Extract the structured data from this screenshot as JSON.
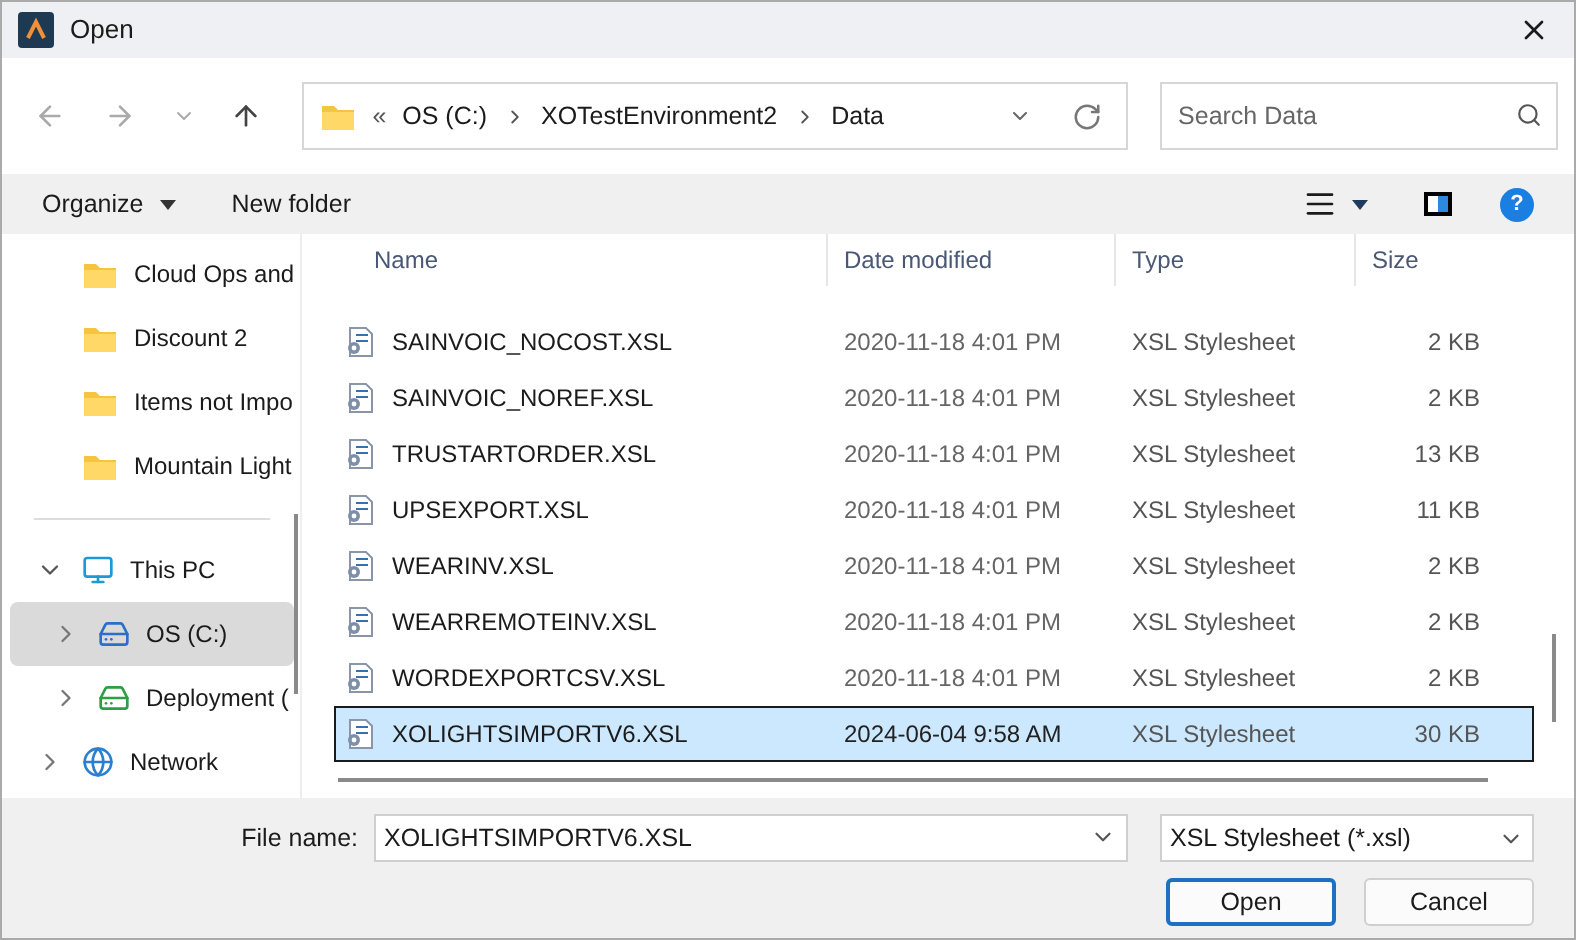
{
  "window": {
    "title": "Open"
  },
  "address_bar": {
    "overflow": "«",
    "path": [
      "OS (C:)",
      "XOTestEnvironment2",
      "Data"
    ]
  },
  "search": {
    "placeholder": "Search Data"
  },
  "toolbar": {
    "organize": "Organize",
    "new_folder": "New folder",
    "help": "?"
  },
  "sidebar": {
    "items": [
      {
        "label": "Cloud Ops and",
        "kind": "folder",
        "selected": false
      },
      {
        "label": "Discount 2",
        "kind": "folder",
        "selected": false
      },
      {
        "label": "Items not Impo",
        "kind": "folder",
        "selected": false
      },
      {
        "label": "Mountain Light",
        "kind": "folder",
        "selected": false
      },
      {
        "label": "This PC",
        "kind": "pc",
        "selected": false,
        "expanded": true,
        "children": [
          {
            "label": "OS (C:)",
            "kind": "os-drive",
            "selected": true,
            "expanded": false
          },
          {
            "label": "Deployment (",
            "kind": "drive",
            "selected": false,
            "expanded": false
          }
        ]
      },
      {
        "label": "Network",
        "kind": "network",
        "selected": false,
        "expanded": false
      }
    ]
  },
  "table": {
    "columns": [
      "Name",
      "Date modified",
      "Type",
      "Size"
    ],
    "rows": [
      {
        "name": "SAINVOIC_NOCOST.XSL",
        "date": "2020-11-18 4:01 PM",
        "type": "XSL Stylesheet",
        "size": "2 KB",
        "selected": false
      },
      {
        "name": "SAINVOIC_NOREF.XSL",
        "date": "2020-11-18 4:01 PM",
        "type": "XSL Stylesheet",
        "size": "2 KB",
        "selected": false
      },
      {
        "name": "TRUSTARTORDER.XSL",
        "date": "2020-11-18 4:01 PM",
        "type": "XSL Stylesheet",
        "size": "13 KB",
        "selected": false
      },
      {
        "name": "UPSEXPORT.XSL",
        "date": "2020-11-18 4:01 PM",
        "type": "XSL Stylesheet",
        "size": "11 KB",
        "selected": false
      },
      {
        "name": "WEARINV.XSL",
        "date": "2020-11-18 4:01 PM",
        "type": "XSL Stylesheet",
        "size": "2 KB",
        "selected": false
      },
      {
        "name": "WEARREMOTEINV.XSL",
        "date": "2020-11-18 4:01 PM",
        "type": "XSL Stylesheet",
        "size": "2 KB",
        "selected": false
      },
      {
        "name": "WORDEXPORTCSV.XSL",
        "date": "2020-11-18 4:01 PM",
        "type": "XSL Stylesheet",
        "size": "2 KB",
        "selected": false
      },
      {
        "name": "XOLIGHTSIMPORTV6.XSL",
        "date": "2024-06-04 9:58 AM",
        "type": "XSL Stylesheet",
        "size": "30 KB",
        "selected": true
      }
    ]
  },
  "footer": {
    "file_name_label": "File name:",
    "file_name": "XOLIGHTSIMPORTV6.XSL",
    "file_type": "XSL Stylesheet (*.xsl)",
    "buttons": [
      "Open",
      "Cancel"
    ]
  }
}
